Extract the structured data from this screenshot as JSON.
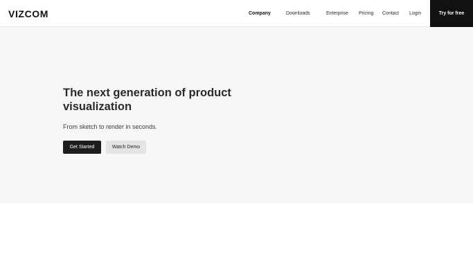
{
  "header": {
    "logo": "VIZCOM",
    "nav": [
      {
        "label": "Company"
      },
      {
        "label": "Downloads"
      },
      {
        "label": "Enterprise"
      },
      {
        "label": "Pricing"
      },
      {
        "label": "Contact"
      },
      {
        "label": "Login"
      }
    ],
    "cta_label": "Try for free"
  },
  "hero": {
    "title": "The next generation of product visualization",
    "subtitle": "From sketch to render in seconds.",
    "primary_button": "Get Started",
    "secondary_button": "Watch Demo"
  },
  "colors": {
    "header_bg": "#ffffff",
    "hero_bg": "#f7f7f7",
    "primary_button_bg": "#1c1c1c",
    "secondary_button_bg": "#e4e4e4",
    "cta_bg": "#111111"
  }
}
